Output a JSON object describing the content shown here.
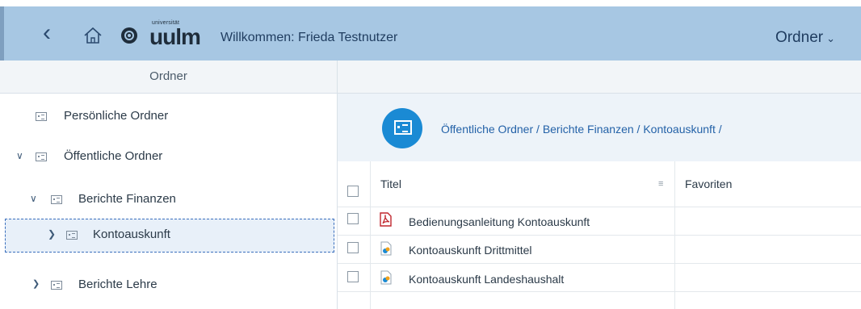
{
  "shell": {
    "logo_small": "universität",
    "logo_text": "uulm",
    "welcome": "Willkommen: Frieda Testnutzer",
    "menu_label": "Ordner"
  },
  "sidebar": {
    "header": "Ordner",
    "items": [
      {
        "label": "Persönliche Ordner"
      },
      {
        "label": "Öffentliche Ordner"
      },
      {
        "label": "Berichte Finanzen"
      },
      {
        "label": "Kontoauskunft"
      },
      {
        "label": "Berichte Lehre"
      }
    ]
  },
  "breadcrumb": {
    "part1": "Öffentliche Ordner",
    "sep1": " / ",
    "part2": "Berichte Finanzen",
    "sep2": " / ",
    "part3": "Kontoauskunft",
    "sep3": " /"
  },
  "table": {
    "columns": [
      "Titel",
      "Favoriten"
    ],
    "rows": [
      {
        "title": "Bedienungsanleitung Kontoauskunft",
        "type": "pdf"
      },
      {
        "title": "Kontoauskunft Drittmittel",
        "type": "report"
      },
      {
        "title": "Kontoauskunft Landeshaushalt",
        "type": "report"
      }
    ]
  },
  "colors": {
    "shell_bg": "#a7c7e3",
    "accent": "#1a8ad4",
    "link": "#2462a8",
    "pdf": "#c0262d"
  }
}
